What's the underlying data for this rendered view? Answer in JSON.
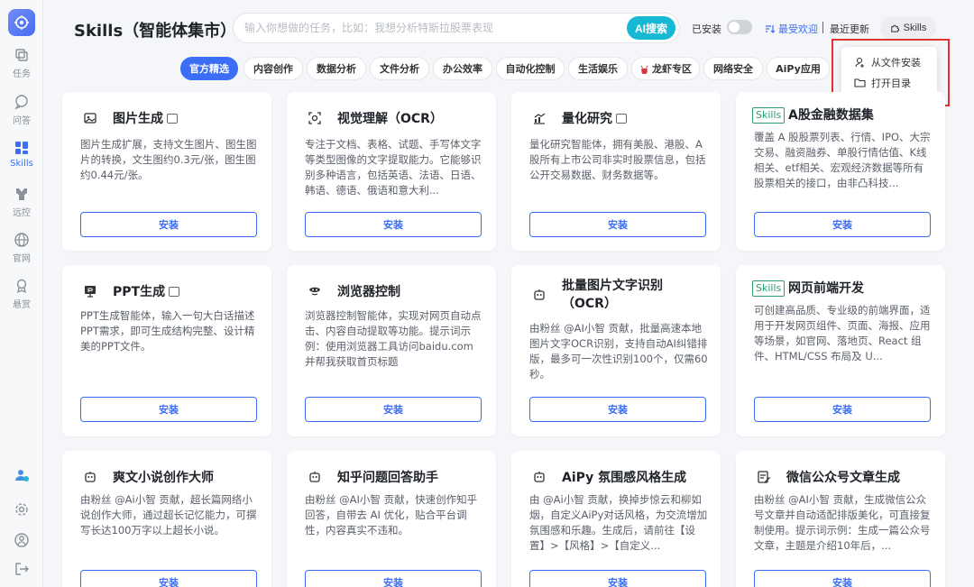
{
  "sidebar": {
    "items": [
      {
        "label": "任务",
        "icon": "layers-icon"
      },
      {
        "label": "问答",
        "icon": "chat-icon"
      },
      {
        "label": "Skills",
        "icon": "grid-icon"
      },
      {
        "label": "远控",
        "icon": "remote-control-icon"
      },
      {
        "label": "官网",
        "icon": "globe-icon"
      },
      {
        "label": "悬赏",
        "icon": "reward-icon"
      }
    ]
  },
  "header": {
    "title": "Skills（智能体集市）",
    "search_placeholder": "输入你想做的任务，比如：我想分析特斯拉股票表现",
    "ai_search": "AI搜索",
    "installed": "已安装",
    "sort_popular": "最受欢迎",
    "sort_recent": "最近更新",
    "skills_button": "Skills"
  },
  "dropdown": {
    "install_from_file": "从文件安装",
    "open_directory": "打开目录"
  },
  "tabs": [
    "官方精选",
    "内容创作",
    "数据分析",
    "文件分析",
    "办公效率",
    "自动化控制",
    "生活娱乐",
    "龙虾专区",
    "网络安全",
    "AiPy应用"
  ],
  "skills_tag": "Skills",
  "install_label": "安装",
  "cards": [
    {
      "title": "图片生成",
      "desc": "图片生成扩展，支持文生图片、图生图片的转换，文生图约0.3元/张，图生图约0.44元/张。"
    },
    {
      "title": "视觉理解（OCR）",
      "desc": "专注于文档、表格、试题、手写体文字等类型图像的文字提取能力。它能够识别多种语言，包括英语、法语、日语、韩语、德语、俄语和意大利..."
    },
    {
      "title": "量化研究",
      "desc": "量化研究智能体，拥有美股、港股、A股所有上市公司非实时股票信息，包括公开交易数据、财务数据等。"
    },
    {
      "title": "A股金融数据集",
      "desc": "覆盖 A 股股票列表、行情、IPO、大宗交易、融资融券、单股行情估值、K线相关、etf相关、宏观经济数据等所有股票相关的接口，由非凸科技..."
    },
    {
      "title": "PPT生成",
      "desc": "PPT生成智能体，输入一句大白话描述PPT需求，即可生成结构完整、设计精美的PPT文件。"
    },
    {
      "title": "浏览器控制",
      "desc": "浏览器控制智能体，实现对网页自动点击、内容自动提取等功能。提示词示例：使用浏览器工具访问baidu.com 并帮我获取首页标题"
    },
    {
      "title": "批量图片文字识别（OCR）",
      "desc": "由粉丝 @AI小智 贡献，批量高速本地图片文字OCR识别，支持自动AI纠错排版，最多可一次性识别100个，仅需60秒。"
    },
    {
      "title": "网页前端开发",
      "desc": "可创建高品质、专业级的前端界面，适用于开发网页组件、页面、海报、应用等场景，如官网、落地页、React 组件、HTML/CSS 布局及 U..."
    },
    {
      "title": "爽文小说创作大师",
      "desc": "由粉丝 @Ai小智 贡献，超长篇网络小说创作大师，通过超长记忆能力，可撰写长达100万字以上超长小说。"
    },
    {
      "title": "知乎问题回答助手",
      "desc": "由粉丝 @AI小智 贡献，快速创作知乎回答，自带去 AI 优化，贴合平台调性，内容真实不违和。"
    },
    {
      "title": "AiPy 氛围感风格生成",
      "desc": "由 @Ai小智 贡献，换掉步惊云和柳如烟，自定义AiPy对话风格，为交流增加氛围感和乐趣。生成后，请前往【设置】>【风格】>【自定义..."
    },
    {
      "title": "微信公众号文章生成",
      "desc": "由粉丝 @AI小智 贡献，生成微信公众号文章并自动适配排版美化，可直接复制使用。提示词示例：生成一篇公众号文章，主题是介绍10年后，..."
    }
  ]
}
